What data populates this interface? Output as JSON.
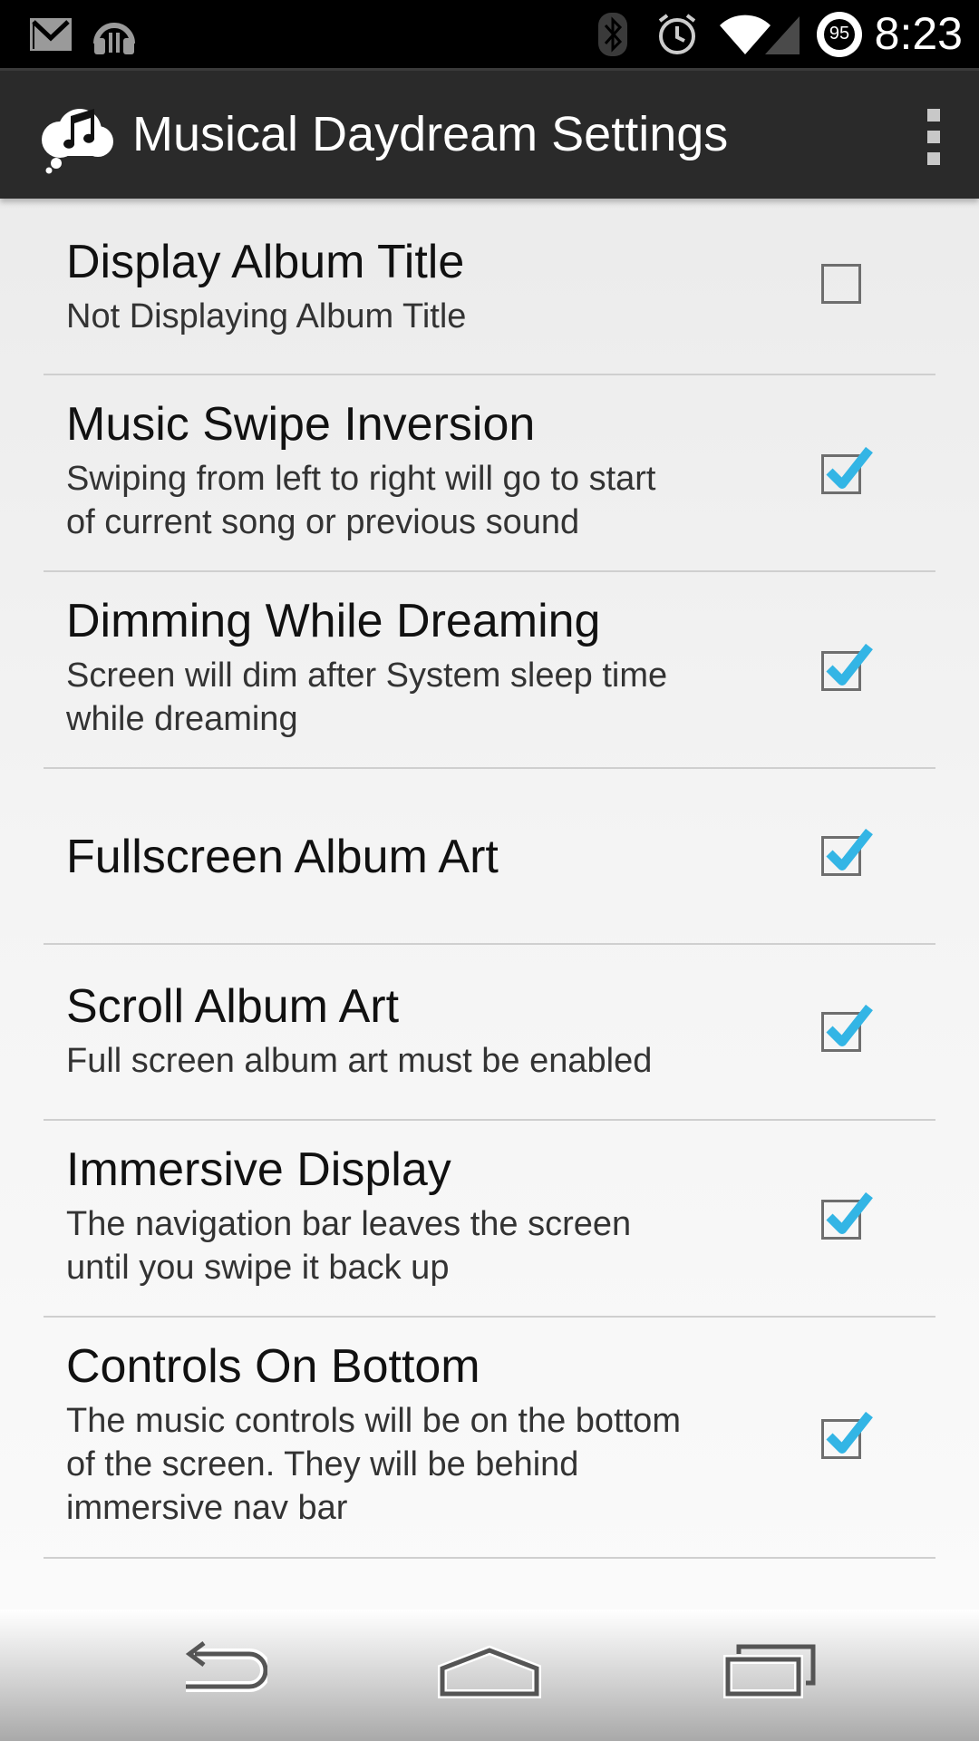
{
  "status_bar": {
    "time": "8:23",
    "battery_level": "95",
    "icons": [
      "gmail-icon",
      "headphones-icon",
      "bluetooth-icon",
      "alarm-icon",
      "wifi-icon",
      "signal-icon",
      "battery-icon"
    ]
  },
  "action_bar": {
    "title": "Musical Daydream Settings",
    "app_icon": "music-cloud-icon",
    "overflow_icon": "overflow-menu-icon"
  },
  "preferences": [
    {
      "title": "Display Album Title",
      "summary": [
        "Not Displaying Album Title"
      ],
      "checked": false
    },
    {
      "title": "Music Swipe Inversion",
      "summary": [
        "Swiping from left to right will go to start",
        "of current song or previous sound"
      ],
      "checked": true
    },
    {
      "title": "Dimming While Dreaming",
      "summary": [
        "Screen will dim after System sleep time",
        "while dreaming"
      ],
      "checked": true
    },
    {
      "title": "Fullscreen Album Art",
      "summary": [],
      "checked": true
    },
    {
      "title": "Scroll Album Art",
      "summary": [
        "Full screen album art must be enabled"
      ],
      "checked": true
    },
    {
      "title": "Immersive Display",
      "summary": [
        "The navigation bar leaves the screen",
        "until you swipe it back up"
      ],
      "checked": true
    },
    {
      "title": "Controls On Bottom",
      "summary": [
        "The music controls will be on the bottom",
        "of the screen. They will be behind",
        "immersive nav bar"
      ],
      "checked": true
    }
  ],
  "nav_bar": {
    "buttons": [
      "back-icon",
      "home-icon",
      "recent-apps-icon"
    ]
  },
  "colors": {
    "checkmark": "#33b5e5",
    "action_bar": "#2a2a2a",
    "status_bar": "#000000"
  }
}
